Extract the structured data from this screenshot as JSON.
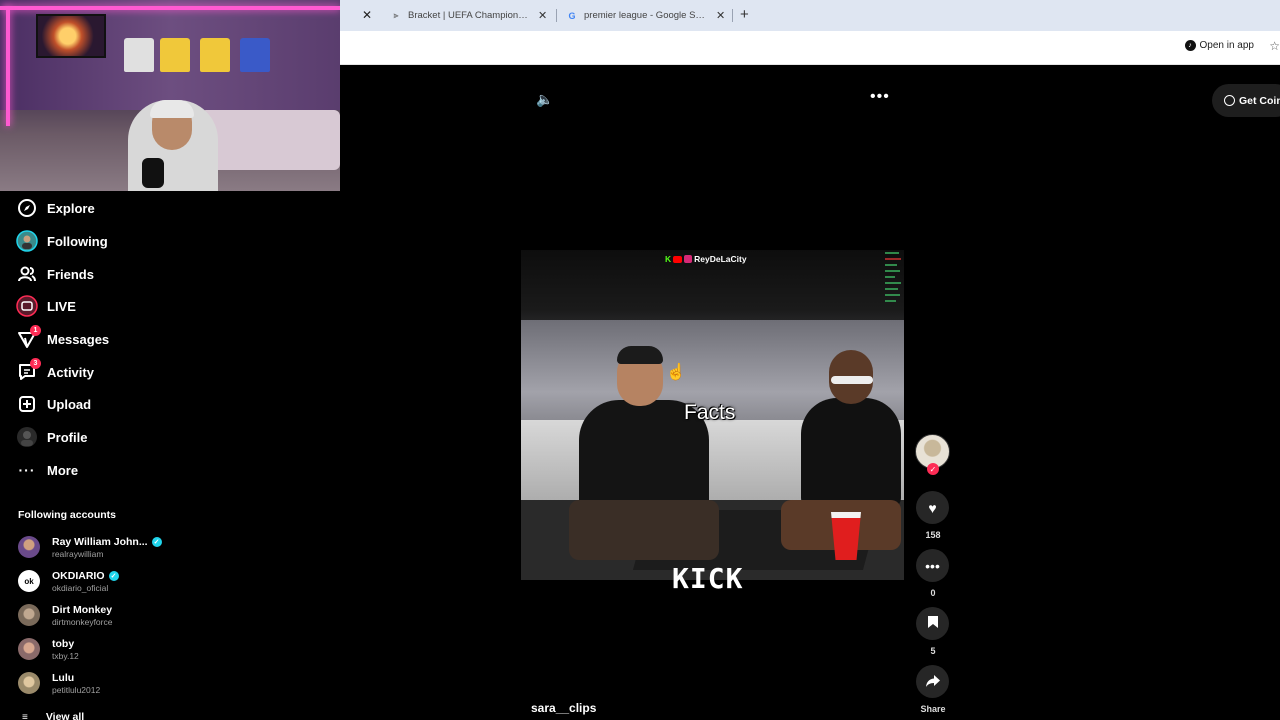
{
  "browser": {
    "tabs": [
      {
        "title": "Bracket | UEFA Champions Lea",
        "favicon": "uefa-icon"
      },
      {
        "title": "premier league - Google Search",
        "favicon": "google-icon"
      }
    ],
    "open_in_app": "Open in app"
  },
  "sidebar": {
    "items": [
      {
        "label": "Explore",
        "icon": "compass-icon"
      },
      {
        "label": "Following",
        "icon": "following-avatar-icon"
      },
      {
        "label": "Friends",
        "icon": "friends-icon"
      },
      {
        "label": "LIVE",
        "icon": "live-icon"
      },
      {
        "label": "Messages",
        "icon": "messages-icon",
        "badge": "1"
      },
      {
        "label": "Activity",
        "icon": "activity-icon",
        "badge": "3"
      },
      {
        "label": "Upload",
        "icon": "upload-icon"
      },
      {
        "label": "Profile",
        "icon": "profile-avatar-icon"
      },
      {
        "label": "More",
        "icon": "more-icon"
      }
    ],
    "following_title": "Following accounts",
    "accounts": [
      {
        "name": "Ray William John...",
        "handle": "realraywilliam",
        "verified": true,
        "color": "#6a4a8a"
      },
      {
        "name": "OKDIARIO",
        "handle": "okdiario_oficial",
        "verified": true,
        "color": "#ffffff"
      },
      {
        "name": "Dirt Monkey",
        "handle": "dirtmonkeyforce",
        "verified": false,
        "color": "#7a6a5a"
      },
      {
        "name": "toby",
        "handle": "txby.12",
        "verified": false,
        "color": "#8a6a6a"
      },
      {
        "name": "Lulu",
        "handle": "petitlulu2012",
        "verified": false,
        "color": "#9a8a6a"
      }
    ],
    "view_all": "View all"
  },
  "video": {
    "get_coins": "Get Coins",
    "streamer_tag": "ReyDeLaCity",
    "kick_k": "K",
    "caption": "Facts",
    "watermark": "KICK",
    "username": "sara__clips"
  },
  "actions": {
    "likes": "158",
    "comments": "0",
    "saves": "5",
    "share": "Share"
  },
  "colors": {
    "accent": "#fe2c55",
    "verified": "#20d5ec",
    "kick_green": "#53fc18"
  }
}
